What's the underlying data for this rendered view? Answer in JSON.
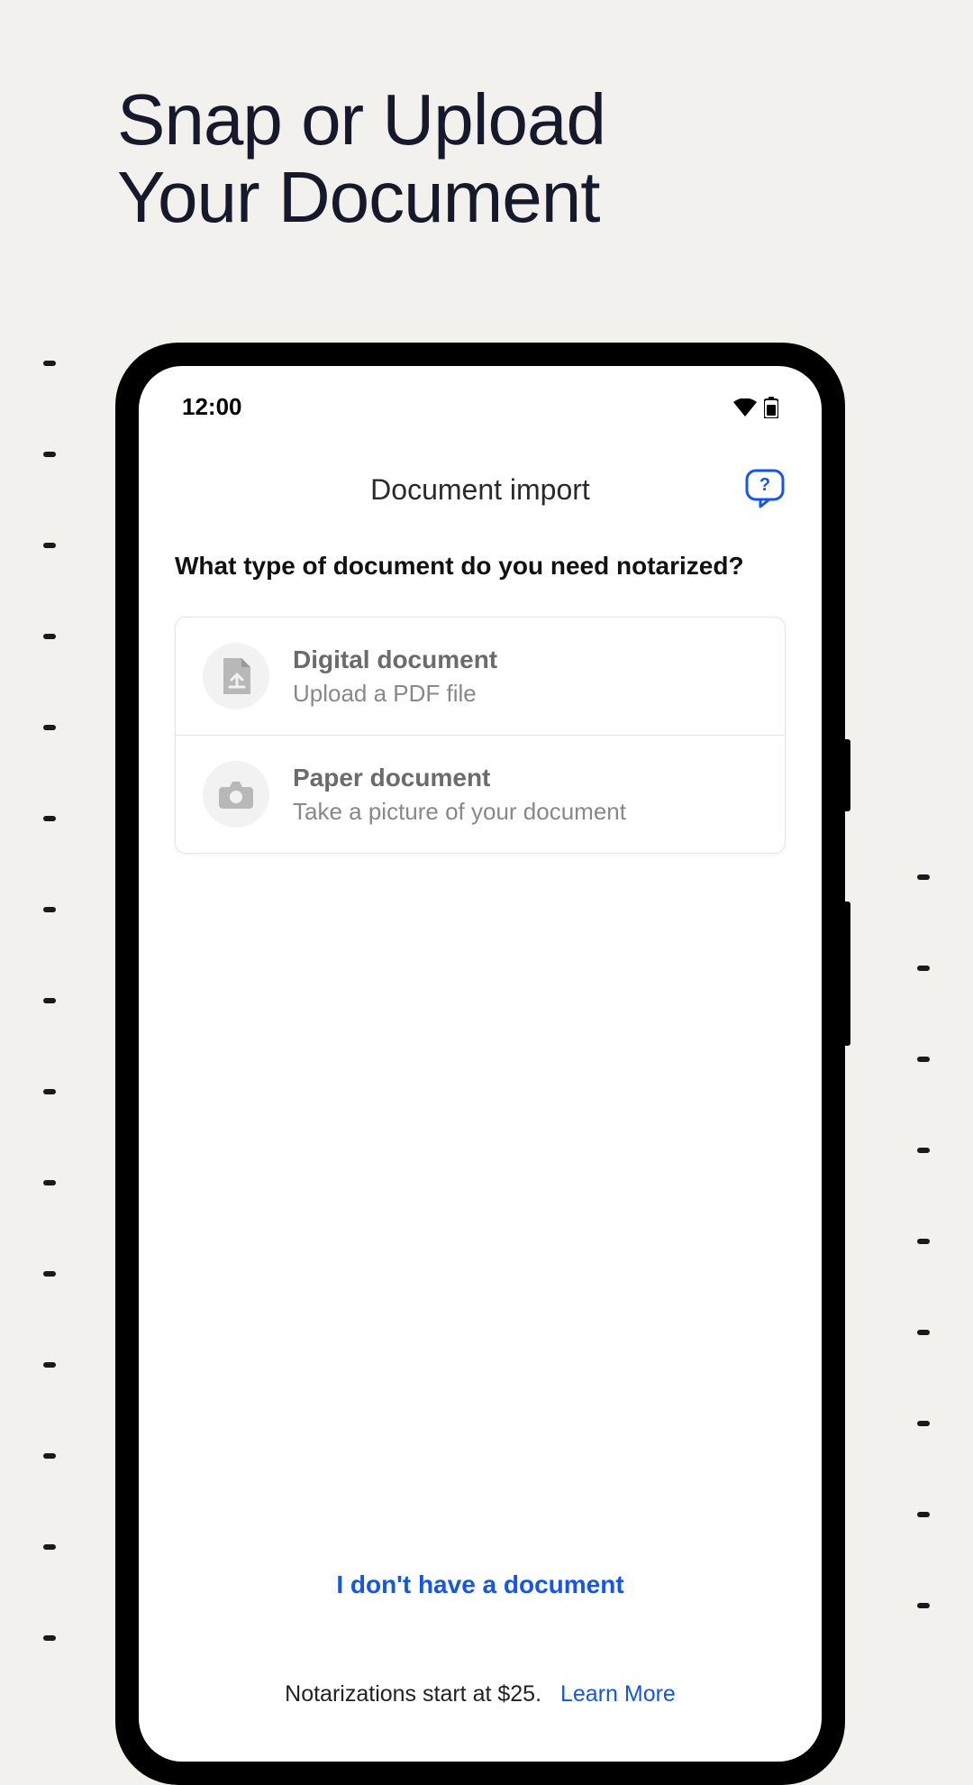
{
  "hero": {
    "line1": "Snap or Upload",
    "line2": "Your Document"
  },
  "status": {
    "time": "12:00"
  },
  "header": {
    "title": "Document import"
  },
  "question": "What type of document do you need notarized?",
  "options": {
    "digital": {
      "title": "Digital document",
      "subtitle": "Upload a PDF file"
    },
    "paper": {
      "title": "Paper document",
      "subtitle": "Take a picture of your document"
    }
  },
  "noDocLink": "I don't have a document",
  "footer": {
    "text": "Notarizations start at $25.",
    "link": "Learn More"
  }
}
